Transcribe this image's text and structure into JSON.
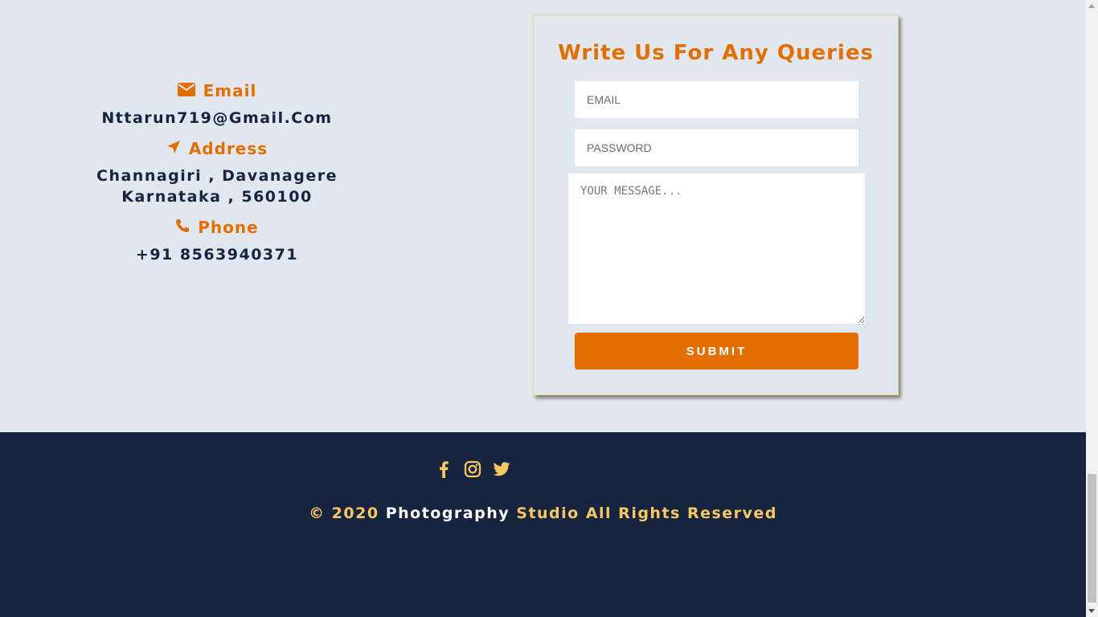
{
  "contact": {
    "email_heading": "Email",
    "email_value": "Nttarun719@Gmail.Com",
    "address_heading": "Address",
    "address_line1": "Channagiri , Davanagere",
    "address_line2": "Karnataka , 560100",
    "phone_heading": "Phone",
    "phone_value": "+91 8563940371",
    "icons": [
      "envelope-icon",
      "location-arrow-icon",
      "phone-icon"
    ]
  },
  "form": {
    "title": "Write Us For Any Queries",
    "email_placeholder": "EMAIL",
    "password_placeholder": "PASSWORD",
    "message_placeholder": "YOUR MESSAGE...",
    "submit_label": "SUBMIT"
  },
  "footer": {
    "social_icons": [
      "facebook-icon",
      "instagram-icon",
      "twitter-icon"
    ],
    "copyright_prefix": "© 2020",
    "brand": "Photography",
    "copyright_suffix": "Studio All Rights Reserved"
  },
  "colors": {
    "accent": "#e46f00",
    "navy": "#162440",
    "background": "#e1e7ee",
    "gold": "#f6c85f"
  }
}
